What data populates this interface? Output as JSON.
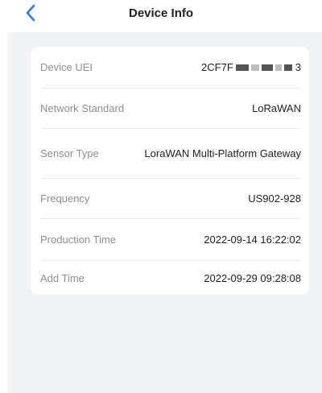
{
  "header": {
    "title": "Device Info"
  },
  "rows": [
    {
      "label": "Device UEI",
      "value_prefix": "2CF7F",
      "value_suffix": "3"
    },
    {
      "label": "Network Standard",
      "value": "LoRaWAN"
    },
    {
      "label": "Sensor Type",
      "value": "LoraWAN Multi-Platform Gateway"
    },
    {
      "label": "Frequency",
      "value": "US902-928"
    },
    {
      "label": "Production Time",
      "value": "2022-09-14 16:22:02"
    },
    {
      "label": "Add Time",
      "value": "2022-09-29 09:28:08"
    }
  ],
  "icons": {
    "back": "chevron-left-icon"
  },
  "colors": {
    "accent": "#3478f6",
    "background": "#f2f3f6",
    "label": "#8e8e93"
  }
}
